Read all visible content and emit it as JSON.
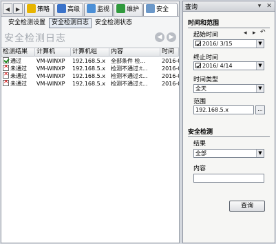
{
  "main_tabs": [
    {
      "label": "策略",
      "icon": "policy-icon"
    },
    {
      "label": "高级",
      "icon": "advanced-icon"
    },
    {
      "label": "监视",
      "icon": "monitor-icon"
    },
    {
      "label": "维护",
      "icon": "maintenance-icon"
    },
    {
      "label": "安全",
      "icon": "security-icon"
    }
  ],
  "sub_tabs": [
    "安全检测设置",
    "安全检测日志",
    "安全检测状态"
  ],
  "page_heading": "安全检测日志",
  "table": {
    "columns": [
      "检测结果",
      "计算机",
      "计算机组",
      "内容",
      "时间"
    ],
    "rows": [
      {
        "status": "pass",
        "result": "通过",
        "computer": "VM-WINXP",
        "group": "192.168.5.x",
        "content": "全部条件 检...",
        "time": "2016-0..."
      },
      {
        "status": "fail",
        "result": "未通过",
        "computer": "VM-WINXP",
        "group": "192.168.5.x",
        "content": "检测不通过:t...",
        "time": "2016-0..."
      },
      {
        "status": "fail",
        "result": "未通过",
        "computer": "VM-WINXP",
        "group": "192.168.5.x",
        "content": "检测不通过:t...",
        "time": "2016-0..."
      },
      {
        "status": "fail",
        "result": "未通过",
        "computer": "VM-WINXP",
        "group": "192.168.5.x",
        "content": "检测不通过:t...",
        "time": "2016-0..."
      }
    ]
  },
  "query_panel": {
    "title": "查询",
    "section_time": "时间和范围",
    "start_time_label": "起始时间",
    "start_date": "2016/ 3/15",
    "end_time_label": "终止时间",
    "end_date": "2016/ 4/14",
    "time_type_label": "时间类型",
    "time_type_value": "全天",
    "range_label": "范围",
    "range_value": "192.168.5.x",
    "browse_label": "...",
    "section_security": "安全检测",
    "result_label": "结果",
    "result_value": "全部",
    "content_label": "内容",
    "content_value": "",
    "query_button": "查询"
  }
}
